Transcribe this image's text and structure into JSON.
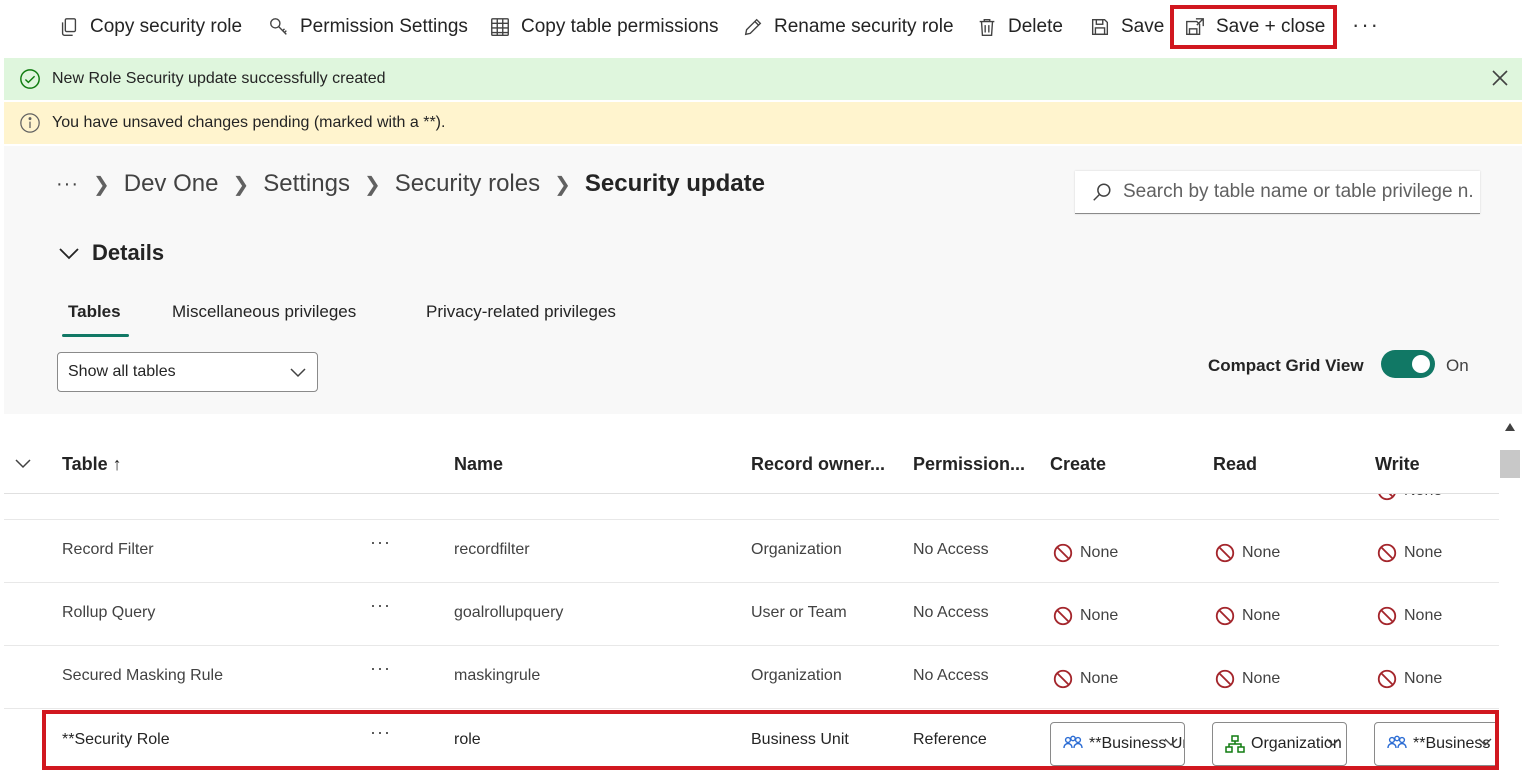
{
  "toolbar": {
    "copy_role": "Copy security role",
    "permission_settings": "Permission Settings",
    "copy_table_permissions": "Copy table permissions",
    "rename_role": "Rename security role",
    "delete": "Delete",
    "save": "Save",
    "save_close": "Save + close",
    "more": "···"
  },
  "banners": {
    "success": "New Role Security update successfully created",
    "warning": "You have unsaved changes pending (marked with a **)."
  },
  "breadcrumb": {
    "more": "···",
    "items": [
      "Dev One",
      "Settings",
      "Security roles"
    ],
    "current": "Security update"
  },
  "search": {
    "placeholder": "Search by table name or table privilege n..."
  },
  "details": {
    "label": "Details"
  },
  "tabs": [
    "Tables",
    "Miscellaneous privileges",
    "Privacy-related privileges"
  ],
  "filter": {
    "value": "Show all tables"
  },
  "compact": {
    "label": "Compact Grid View",
    "state": "On"
  },
  "grid": {
    "headers": {
      "table": "Table ↑",
      "name": "Name",
      "owner": "Record owner...",
      "permission": "Permission...",
      "create": "Create",
      "read": "Read",
      "write": "Write"
    },
    "partial_write": "None",
    "row_more": "···",
    "rows": [
      {
        "table": "Record Filter",
        "name": "recordfilter",
        "owner": "Organization",
        "permission": "No Access",
        "create": "None",
        "read": "None",
        "write": "None"
      },
      {
        "table": "Rollup Query",
        "name": "goalrollupquery",
        "owner": "User or Team",
        "permission": "No Access",
        "create": "None",
        "read": "None",
        "write": "None"
      },
      {
        "table": "Secured Masking Rule",
        "name": "maskingrule",
        "owner": "Organization",
        "permission": "No Access",
        "create": "None",
        "read": "None",
        "write": "None"
      }
    ],
    "selected_row": {
      "table": "**Security Role",
      "name": "role",
      "owner": "Business Unit",
      "permission": "Reference",
      "create": "**Business Unit",
      "read": "Organization",
      "write": "**Business Unit"
    }
  },
  "colors": {
    "accent": "#117865",
    "highlight": "#d1171f",
    "success_bg": "#dff6dd",
    "warning_bg": "#fff4ce",
    "none_icon": "#a4262c"
  }
}
